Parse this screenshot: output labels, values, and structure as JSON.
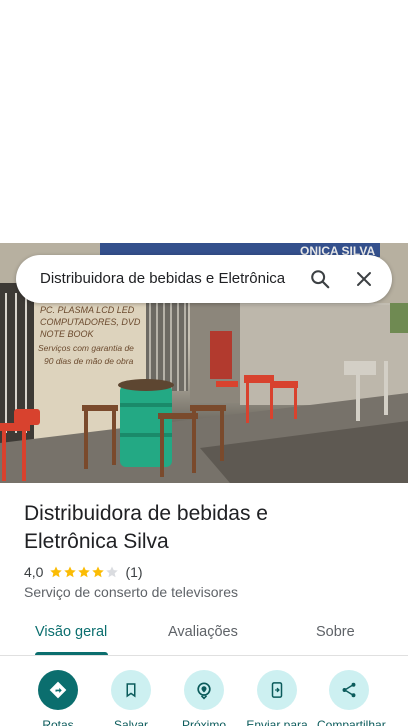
{
  "search": {
    "query": "Distribuidora de bebidas e Eletrônica Silva"
  },
  "photo": {
    "wall_text_1": "PC. PLASMA LCD LED",
    "wall_text_2": "COMPUTADORES, DVD",
    "wall_text_3": "NOTE BOOK",
    "wall_text_4": "Serviços com garantia de",
    "wall_text_5": "90 dias de mão de obra",
    "sign_text": "ONICA SILVA"
  },
  "place": {
    "title": "Distribuidora de bebidas e Eletrônica Silva",
    "rating": "4,0",
    "rating_stars": 4,
    "review_count": "(1)",
    "category": "Serviço de conserto de televisores"
  },
  "tabs": [
    {
      "label": "Visão geral"
    },
    {
      "label": "Avaliações"
    },
    {
      "label": "Sobre"
    }
  ],
  "actions": [
    {
      "label": "Rotas",
      "icon": "directions-icon"
    },
    {
      "label": "Salvar",
      "icon": "bookmark-icon"
    },
    {
      "label": "Próximo",
      "icon": "nearby-icon"
    },
    {
      "label": "Enviar para",
      "icon": "send-to-phone-icon"
    },
    {
      "label": "Compartilhar",
      "icon": "share-icon"
    }
  ],
  "colors": {
    "accent": "#0b6e6e",
    "action_bg": "#cdf0f1",
    "star": "#fbbc04"
  }
}
